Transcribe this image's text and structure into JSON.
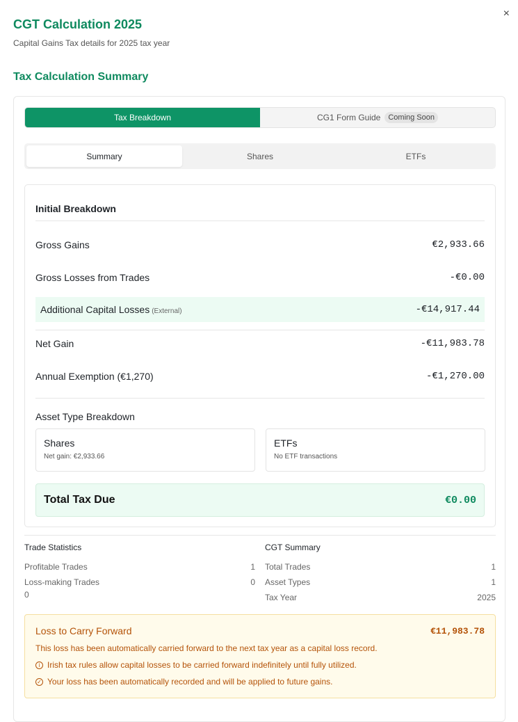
{
  "dialog": {
    "title": "CGT Calculation 2025",
    "subtitle": "Capital Gains Tax details for 2025 tax year",
    "close_icon": "close-icon",
    "close_glyph": "×"
  },
  "section": {
    "title": "Tax Calculation Summary"
  },
  "top_tabs": [
    {
      "label": "Tax Breakdown",
      "active": true
    },
    {
      "label": "CG1 Form Guide",
      "badge": "Coming Soon",
      "active": false
    }
  ],
  "sub_tabs": [
    {
      "label": "Summary",
      "active": true
    },
    {
      "label": "Shares",
      "active": false
    },
    {
      "label": "ETFs",
      "active": false
    }
  ],
  "breakdown": {
    "heading": "Initial Breakdown",
    "rows": [
      {
        "label": "Gross Gains",
        "value": "€2,933.66"
      },
      {
        "label": "Gross Losses from Trades",
        "value": "-€0.00"
      },
      {
        "label": "Additional Capital Losses",
        "note": "(External)",
        "value": "-€14,917.44"
      },
      {
        "label": "Net Gain",
        "value": "-€11,983.78"
      },
      {
        "label": "Annual Exemption (€1,270)",
        "value": "-€1,270.00"
      }
    ],
    "asset_heading": "Asset Type Breakdown",
    "assets": [
      {
        "title": "Shares",
        "detail": "Net gain: €2,933.66"
      },
      {
        "title": "ETFs",
        "detail": "No ETF transactions"
      }
    ],
    "total_label": "Total Tax Due",
    "total_value": "€0.00"
  },
  "trade_stats": {
    "heading": "Trade Statistics",
    "lines": [
      {
        "label": "Profitable Trades",
        "value": "1"
      },
      {
        "label": "Loss-making Trades",
        "value": "0"
      }
    ],
    "extra": "0"
  },
  "cgt_summary": {
    "heading": "CGT Summary",
    "lines": [
      {
        "label": "Total Trades",
        "value": "1"
      },
      {
        "label": "Asset Types",
        "value": "1"
      },
      {
        "label": "Tax Year",
        "value": "2025"
      }
    ]
  },
  "loss_carry": {
    "title": "Loss to Carry Forward",
    "amount": "€11,983.78",
    "line1": "This loss has been automatically carried forward to the next tax year as a capital loss record.",
    "line2": "Irish tax rules allow capital losses to be carried forward indefinitely until fully utilized.",
    "line3": "Your loss has been automatically recorded and will be applied to future gains.",
    "info_icon": "info-icon",
    "check_icon": "check-circle-icon"
  },
  "colors": {
    "brand": "#0e9466",
    "warning": "#b45309",
    "success_bg": "#ecfbf3"
  }
}
